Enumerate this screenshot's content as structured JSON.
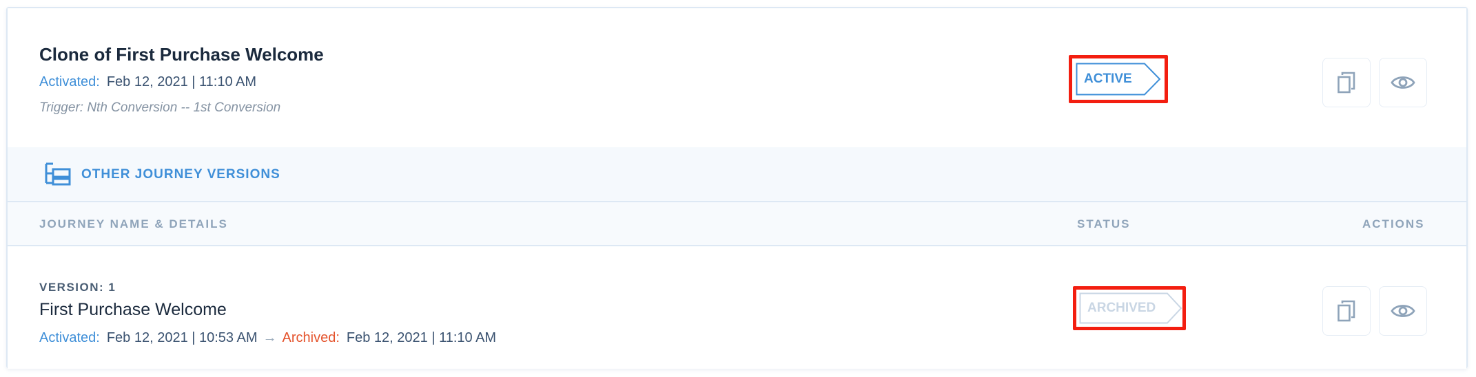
{
  "journey": {
    "title": "Clone of First Purchase Welcome",
    "activated_label": "Activated:",
    "activated_value": "Feb 12, 2021 | 11:10 AM",
    "trigger": "Trigger: Nth Conversion -- 1st Conversion",
    "status": "ACTIVE",
    "status_color": "#3f8fd8"
  },
  "versions_section": {
    "label": "OTHER JOURNEY VERSIONS",
    "icon": "hierarchy-icon"
  },
  "table": {
    "headers": {
      "name": "JOURNEY NAME & DETAILS",
      "status": "STATUS",
      "actions": "ACTIONS"
    },
    "rows": [
      {
        "version_label": "VERSION: 1",
        "name": "First Purchase Welcome",
        "activated_label": "Activated:",
        "activated_value": "Feb 12, 2021 | 10:53 AM",
        "arrow": "→",
        "archived_label": "Archived:",
        "archived_value": "Feb 12, 2021 | 11:10 AM",
        "status": "ARCHIVED",
        "status_color": "#c9d6e4"
      }
    ]
  },
  "actions": {
    "copy_icon": "copy-icon",
    "view_icon": "eye-icon"
  },
  "colors": {
    "accent": "#3f8fd8",
    "archived_label": "#e4532c",
    "highlight": "#f31e10"
  }
}
